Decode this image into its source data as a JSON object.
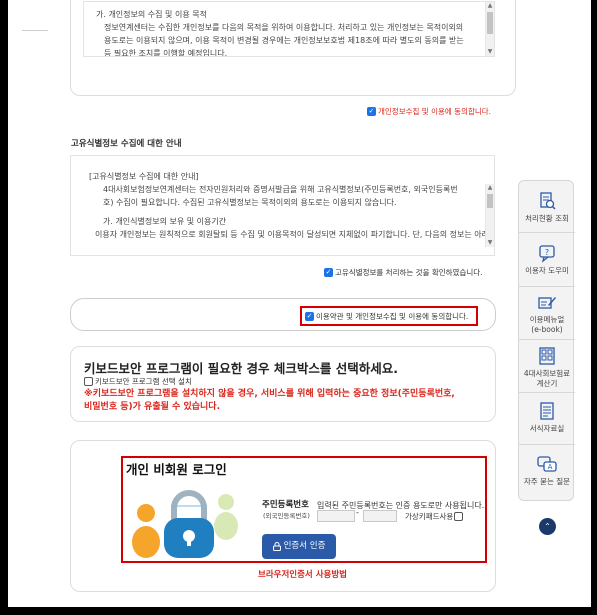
{
  "privacy": {
    "item_heading": "가. 개인정보의 수집 및 이용 목적",
    "lines": [
      "정보연계센터는 수집한 개인정보를 다음의 목적을 위하여 이용합니다. 처리하고 있는 개인정보는 목적이외의",
      "용도로는 이용되지 않으며, 이용 목적이 변경될 경우에는 개인정보보호법 제18조에 따라 별도의 동의를 받는",
      "등 필요한 조치를 이행할 예정입니다."
    ],
    "agree_label": "개인정보수집 및 이용에 동의합니다."
  },
  "unique_id": {
    "title": "고유식별정보 수집에 대한 안내",
    "lines": [
      "[고유식별정보 수집에 대한 안내]",
      "4대사회보험정보연계센터는 전자민원처리와 증명서발급을 위해 고유식별정보(주민등록번호, 외국인등록번",
      "호) 수집이 필요합니다. 수집된 고유식별정보는 목적이외의 용도로는 이용되지 않습니다.",
      "",
      "가. 개인식별정보의 보유 및 이용기간",
      "이용자 개인정보는 원칙적으로 회원탈퇴 등 수집 및 이용목적이 달성되면 지체없이 파기합니다. 단, 다음의 정보는 아래의 이유로"
    ],
    "agree_label": "고유식별정보를 처리하는 것을 확인하였습니다."
  },
  "all_agree": {
    "label": "이용약관 및 개인정보수집 및 이용에 동의합니다."
  },
  "keyboard": {
    "title": "키보드보안 프로그램이 필요한 경우 체크박스를 선택하세요.",
    "checkbox_label": "키보드보안 프로그램 선택 설치",
    "warning": "※키보드보안 프로그램을 설치하지 않을 경우, 서비스를 위해 입력하는 중요한 정보(주민등록번호,",
    "warning2": "비밀번호 등)가 유출될 수 있습니다."
  },
  "login": {
    "title": "개인 비회원 로그인",
    "rrn_label": "주민등록번호",
    "rrn_sub": "(외국인등록번호)",
    "rrn_notice": "입력된 주민등록번호는 인증 용도로만 사용됩니다.",
    "rrn_separator": "-",
    "virtual_keyboard_label": "가상키패드사용",
    "cert_button": "인증서 인증",
    "browser_cert_link": "브라우저인증서 사용방법"
  },
  "side_menu": [
    {
      "label": "처리현황 조회",
      "icon": "search-document-icon"
    },
    {
      "label": "이용자 도우미",
      "icon": "help-chat-icon"
    },
    {
      "label": "이용메뉴얼\n(e-book)",
      "icon": "manual-edit-icon"
    },
    {
      "label": "4대사회보험료\n계산기",
      "icon": "calculator-icon"
    },
    {
      "label": "서식자료실",
      "icon": "form-document-icon"
    },
    {
      "label": "자주 묻는 질문",
      "icon": "faq-icon"
    }
  ],
  "scroll_top_icon": "chevron-up-icon",
  "colors": {
    "accent_blue": "#1a73e8",
    "highlight_red": "#d40000",
    "button_blue": "#2b5aa8"
  }
}
